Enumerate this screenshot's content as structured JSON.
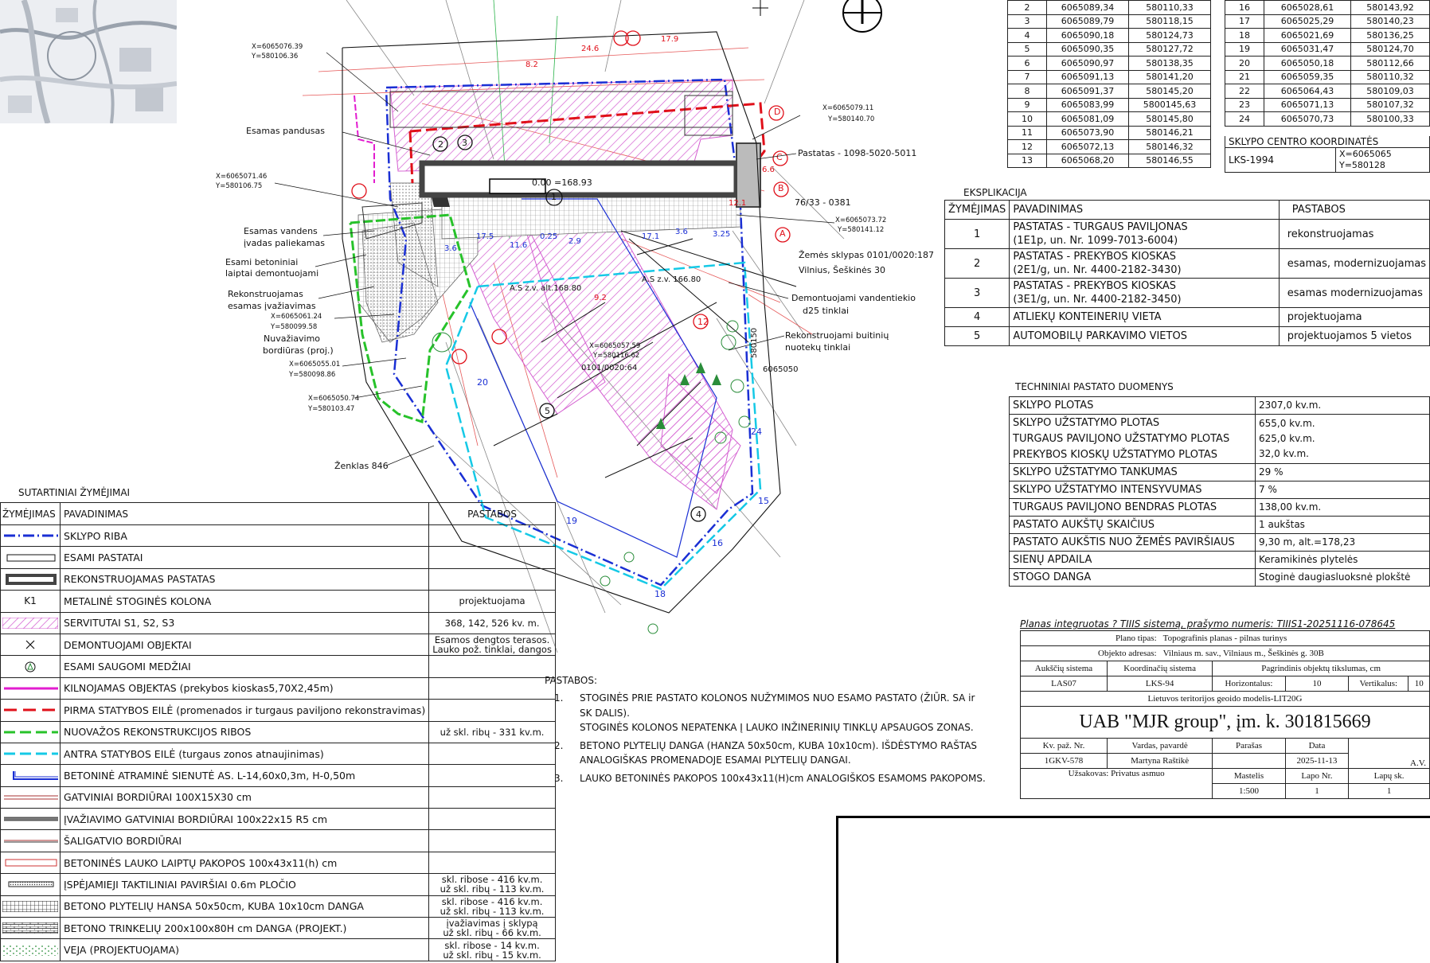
{
  "coord_table_left": {
    "rows": [
      [
        "2",
        "6065089,34",
        "580110,33"
      ],
      [
        "3",
        "6065089,79",
        "580118,15"
      ],
      [
        "4",
        "6065090,18",
        "580124,73"
      ],
      [
        "5",
        "6065090,35",
        "580127,72"
      ],
      [
        "6",
        "6065090,97",
        "580138,35"
      ],
      [
        "7",
        "6065091,13",
        "580141,20"
      ],
      [
        "8",
        "6065091,37",
        "580145,20"
      ],
      [
        "9",
        "6065083,99",
        "5800145,63"
      ],
      [
        "10",
        "6065081,09",
        "580145,80"
      ],
      [
        "11",
        "6065073,90",
        "580146,21"
      ],
      [
        "12",
        "6065072,13",
        "580146,32"
      ],
      [
        "13",
        "6065068,20",
        "580146,55"
      ]
    ]
  },
  "coord_table_right": {
    "rows": [
      [
        "16",
        "6065028,61",
        "580143,92"
      ],
      [
        "17",
        "6065025,29",
        "580140,23"
      ],
      [
        "18",
        "6065021,69",
        "580136,25"
      ],
      [
        "19",
        "6065031,47",
        "580124,70"
      ],
      [
        "20",
        "6065050,18",
        "580112,66"
      ],
      [
        "21",
        "6065059,35",
        "580110,32"
      ],
      [
        "22",
        "6065064,43",
        "580109,03"
      ],
      [
        "23",
        "6065071,13",
        "580107,32"
      ],
      [
        "24",
        "6065070,73",
        "580100,33"
      ]
    ],
    "center_title": "SKLYPO CENTRO KOORDINATĖS",
    "center_system": "LKS-1994",
    "center_x": "X=6065065",
    "center_y": "Y=580128"
  },
  "eksplikacija": {
    "title": "EKSPLIKACIJA",
    "headers": [
      "ŽYMĖJIMAS",
      "PAVADINIMAS",
      "PASTABOS"
    ],
    "rows": [
      {
        "n": "1",
        "name1": "PASTATAS - TURGAUS PAVILJONAS",
        "name2": "(1E1p, un. Nr. 1099-7013-6004)",
        "note": "rekonstruojamas"
      },
      {
        "n": "2",
        "name1": "PASTATAS - PREKYBOS KIOSKAS",
        "name2": "(2E1/g, un. Nr. 4400-2182-3430)",
        "note": "esamas, modernizuojamas"
      },
      {
        "n": "3",
        "name1": "PASTATAS - PREKYBOS KIOSKAS",
        "name2": "(3E1/g, un. Nr. 4400-2182-3450)",
        "note": "esamas modernizuojamas"
      },
      {
        "n": "4",
        "name1": "ATLIEKŲ KONTEINERIŲ VIETA",
        "name2": "",
        "note": "projektuojama"
      },
      {
        "n": "5",
        "name1": "AUTOMOBILŲ PARKAVIMO VIETOS",
        "name2": "",
        "note": "projektuojamos 5 vietos"
      }
    ]
  },
  "tech": {
    "title": "TECHNINIAI PASTATO DUOMENYS",
    "rows": [
      {
        "k": [
          "SKLYPO PLOTAS"
        ],
        "v": [
          "2307,0 kv.m."
        ]
      },
      {
        "k": [
          "SKLYPO UŽSTATYMO PLOTAS",
          "TURGAUS PAVILJONO UŽSTATYMO PLOTAS",
          "PREKYBOS KIOSKŲ UŽSTATYMO PLOTAS"
        ],
        "v": [
          "655,0 kv.m.",
          "625,0 kv.m.",
          "32,0 kv.m."
        ]
      },
      {
        "k": [
          "SKLYPO UŽSTATYMO TANKUMAS"
        ],
        "v": [
          "29 %"
        ]
      },
      {
        "k": [
          "SKLYPO UŽSTATYMO INTENSYVUMAS"
        ],
        "v": [
          "7 %"
        ]
      },
      {
        "k": [
          "TURGAUS PAVILJONO BENDRAS PLOTAS"
        ],
        "v": [
          "138,00 kv.m."
        ]
      },
      {
        "k": [
          "PASTATO AUKŠTŲ SKAIČIUS"
        ],
        "v": [
          "1 aukštas"
        ]
      },
      {
        "k": [
          "PASTATO AUKŠTIS NUO ŽEMĖS PAVIRŠIAUS"
        ],
        "v": [
          "9,30 m, alt.=178,23"
        ]
      },
      {
        "k": [
          "SIENŲ APDAILA"
        ],
        "v": [
          "Keramikinės plytelės"
        ]
      },
      {
        "k": [
          "STOGO DANGA"
        ],
        "v": [
          "Stoginė daugiasluoksnė plokštė"
        ]
      }
    ]
  },
  "stamp": {
    "integrated": "Planas integruotas ? TIIIS sistemą, prašymo numeris: TIIIS1-20251116-078645",
    "plan_type_label": "Plano tipas:",
    "plan_type": "Topografinis planas - pilnas turinys",
    "address_label": "Objekto adresas:",
    "address": "Vilniaus m. sav., Vilniaus m., Šeškinės g. 30B",
    "h_system_label": "Aukščių sistema",
    "c_system_label": "Koordinačių sistema",
    "accuracy_label": "Pagrindinis objektų tikslumas, cm",
    "h_system": "LAS07",
    "c_system": "LKS-94",
    "horiz_label": "Horizontalus:",
    "horiz": "10",
    "vert_label": "Vertikalus:",
    "vert": "10",
    "geoid": "Lietuvos teritorijos geoido modelis-LIT20G",
    "company": "UAB \"MJR group\", įm. k. 301815669",
    "kv_label": "Kv. paž. Nr.",
    "name_label": "Vardas, pavardė",
    "sign_label": "Parašas",
    "date_label": "Data",
    "kv": "1GKV-578",
    "name": "Martyna Raštikė",
    "date": "2025-11-13",
    "av": "A.V.",
    "client": "Užsakovas: Privatus asmuo",
    "scale_label": "Mastelis",
    "sheet_label": "Lapo Nr.",
    "sheets_label": "Lapų sk.",
    "scale": "1:500",
    "sheet": "1",
    "sheets": "1"
  },
  "legend": {
    "title": "SUTARTINIAI ŽYMĖJIMAI",
    "headers": [
      "ŽYMĖJIMAS",
      "PAVADINIMAS",
      "PASTABOS"
    ],
    "rows": [
      {
        "sym": "blue-dash",
        "name": "SKLYPO RIBA",
        "note": ""
      },
      {
        "sym": "rect-thin",
        "name": "ESAMI PASTATAI",
        "note": ""
      },
      {
        "sym": "rect-thick",
        "name": "REKONSTRUOJAMAS PASTATAS",
        "note": ""
      },
      {
        "sym": "K1",
        "name": "METALINĖ STOGINĖS KOLONA",
        "note": "projektuojama"
      },
      {
        "sym": "hatch",
        "name": "SERVITUTAI S1, S2, S3",
        "note": "368, 142, 526 kv. m."
      },
      {
        "sym": "cross",
        "name": "DEMONTUOJAMI OBJEKTAI",
        "note": "Esamos dengtos terasos.|Lauko pož. tinklai, dangos"
      },
      {
        "sym": "tree",
        "name": "ESAMI SAUGOMI MEDŽIAI",
        "note": ""
      },
      {
        "sym": "magenta",
        "name": "KILNOJAMAS OBJEKTAS (prekybos kioskas5,70X2,45m)",
        "note": ""
      },
      {
        "sym": "red-dash",
        "name": "PIRMA STATYBOS EILĖ (promenados ir turgaus paviljono rekonstravimas)",
        "note": ""
      },
      {
        "sym": "green-dash",
        "name": "NUOVAŽOS REKONSTRUKCIJOS RIBOS",
        "note": "už skl. ribų - 331 kv.m."
      },
      {
        "sym": "cyan-dash",
        "name": "ANTRA STATYBOS EILĖ (turgaus zonos atnaujinimas)",
        "note": ""
      },
      {
        "sym": "wall",
        "name": "BETONINĖ ATRAMINĖ SIENUTĖ AS. L-14,60x0,3m, H-0,50m",
        "note": ""
      },
      {
        "sym": "curb-red",
        "name": "GATVINIAI BORDIŪRAI 100X15X30 cm",
        "note": ""
      },
      {
        "sym": "curb-dark",
        "name": "ĮVAŽIAVIMO GATVINIAI BORDIŪRAI 100x22x15 R5 cm",
        "note": ""
      },
      {
        "sym": "curb-thin",
        "name": "ŠALIGATVIO BORDIŪRAI",
        "note": ""
      },
      {
        "sym": "steps",
        "name": "BETONINĖS LAUKO  LAIPTŲ PAKOPOS 100x43x11(h) cm",
        "note": ""
      },
      {
        "sym": "tactile",
        "name": "ĮSPĖJAMIEJI TAKTILINIAI PAVIRŠIAI 0.6m PLOČIO",
        "note": "skl. ribose - 416 kv.m.|už skl. ribų - 113 kv.m."
      },
      {
        "sym": "tiles",
        "name": "BETONO PLYTELIŲ HANSA 50x50cm, KUBA 10x10cm DANGA",
        "note": "skl. ribose - 416 kv.m.|už skl. ribų - 113 kv.m."
      },
      {
        "sym": "pavers",
        "name": "BETONO TRINKELIŲ 200x100x80H cm  DANGA (PROJEKT.)",
        "note": "įvažiavimas į sklypą|už skl. ribų - 66 kv.m."
      },
      {
        "sym": "grass",
        "name": "VEJA (PROJEKTUOJAMA)",
        "note": "skl. ribose - 14 kv.m.|už skl. ribų - 15 kv.m."
      }
    ]
  },
  "notes": {
    "title": "PASTABOS:",
    "items": [
      {
        "n": "1.",
        "lines": [
          "STOGINĖS PRIE PASTATO KOLONOS NUŽYMIMOS NUO ESAMO PASTATO (ŽIŪR. SA ir",
          "SK DALIS).",
          "STOGINĖS KOLONOS NEPATENKA Į LAUKO INŽINERINIŲ TINKLŲ APSAUGOS  ZONAS."
        ]
      },
      {
        "n": "2.",
        "lines": [
          "BETONO PLYTELIŲ DANGA (HANZA 50x50cm, KUBA 10x10cm). IŠDĖSTYMO RAŠTAS",
          "ANALOGIŠKAS PROMENADOJE ESAMAI PLYTELIŲ DANGAI."
        ]
      },
      {
        "n": "3.",
        "lines": [
          "LAUKO BETONINĖS PAKOPOS 100x43x11(H)cm ANALOGIŠKOS ESAMOMS PAKOPOMS."
        ]
      }
    ]
  },
  "plan_labels": {
    "esamas_pandusas": "Esamas pandusas",
    "esamas_vandens_1": "Esamas vandens",
    "esamas_vandens_2": "įvadas paliekamas",
    "laiptai_1": "Esami betoniniai",
    "laiptai_2": "laiptai demontuojami",
    "ivaziavimas_1": "Rekonstruojamas",
    "ivaziavimas_2": "esamas įvažiavimas",
    "borduras_1": "Nuvažiavimo",
    "borduras_2": "bordiūras (proj.)",
    "zenklas": "Ženklas 846",
    "pastatas": "Pastatas - 1098-5020-5011",
    "parcel_code": "76/33 - 0381",
    "zemes_1": "Žemės sklypas 0101/0020:187",
    "zemes_2": "Vilnius, Šeškinės 30",
    "demont_1": "Demontuojami vandentiekio",
    "demont_2": "d25 tinklai",
    "rekon_1": "Rekonstruojami  buitinių",
    "rekon_2": "nuotekų tinklai",
    "elev_main": "0.00 =168.93",
    "elev_a1": "A.S z.v. alt.168.80",
    "elev_a2": "A.S z.v. 166.80",
    "parcel_small": "0101/0020:64",
    "num_6065050": "6065050",
    "num_580150": "580150",
    "c1x": "X=6065076.39",
    "c1y": "Y=580106.36",
    "c2x": "X=6065071.46",
    "c2y": "Y=580106.75",
    "c3x": "X=6065061.24",
    "c3y": "Y=580099.58",
    "c4x": "X=6065055.01",
    "c4y": "Y=580098.86",
    "c5x": "X=6065050.74",
    "c5y": "Y=580103.47",
    "c6x": "X=6065079.11",
    "c6y": "Y=580140.70",
    "c7x": "X=6065073.72",
    "c7y": "Y=580141.12",
    "c8x": "X=6065057.59",
    "c8y": "Y=580116.62",
    "axis_a": "A",
    "axis_b": "B",
    "axis_c": "C",
    "axis_d": "D",
    "p15": "15",
    "p16": "16",
    "p18": "18",
    "p19": "19",
    "p20": "20",
    "p24": "24",
    "p12": "12",
    "d_246": "24.6",
    "d_82": "8.2",
    "d_179": "17.9",
    "d_175": "17.5",
    "d_116": "11.6",
    "d_36": "3.6",
    "d_171": "17.1",
    "d_29": "2.9",
    "d_025": "0.25",
    "d_325": "3.25",
    "d_36b": "3.6",
    "d_66": "6.6",
    "d_92": "9.2",
    "d_121": "12.1",
    "b1": "1",
    "b2": "2",
    "b3": "3",
    "b4": "4",
    "b5": "5"
  },
  "colors": {
    "blue": "#1a2fd4",
    "red": "#e0101a",
    "green": "#27c22a",
    "cyan": "#15c9e6",
    "magenta": "#e21ccf",
    "hatch": "#d45fd1",
    "dark": "#444444"
  }
}
